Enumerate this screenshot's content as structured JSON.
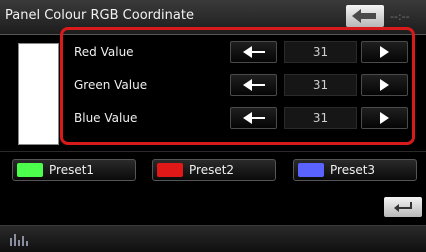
{
  "header": {
    "title": "Panel Colour RGB Coordinate",
    "clock": "--:--"
  },
  "rows": [
    {
      "label": "Red Value",
      "value": "31"
    },
    {
      "label": "Green Value",
      "value": "31"
    },
    {
      "label": "Blue Value",
      "value": "31"
    }
  ],
  "presets": [
    {
      "label": "Preset1",
      "color": "#4cff4c"
    },
    {
      "label": "Preset2",
      "color": "#e01818"
    },
    {
      "label": "Preset3",
      "color": "#5b63ff"
    }
  ],
  "colors": {
    "highlight_border": "#d91a1a",
    "preview_fill": "#ffffff"
  },
  "icons": {
    "top_back": "back-arrow-icon",
    "return": "return-icon",
    "decrease": "left-triangle-icon",
    "increase": "right-triangle-icon",
    "menu": "equalizer-icon"
  }
}
